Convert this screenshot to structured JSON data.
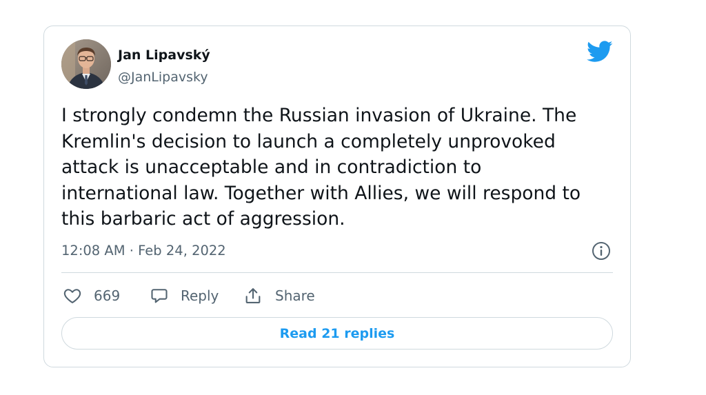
{
  "author": {
    "name": "Jan Lipavský",
    "handle": "@JanLipavsky"
  },
  "brand_icon": "twitter-bird-icon",
  "tweet": {
    "lines": [
      "I strongly condemn the Russian invasion of Ukraine. The",
      "Kremlin's decision to launch a completely unprovoked",
      "attack is unacceptable and in contradiction to",
      "international law. Together with Allies, we will respond to",
      "this barbaric act of aggression."
    ],
    "timestamp": "12:08 AM · Feb 24, 2022"
  },
  "actions": {
    "like_count": "669",
    "reply_label": "Reply",
    "share_label": "Share"
  },
  "read_replies_label": "Read 21 replies",
  "colors": {
    "accent": "#1d9bf0",
    "text": "#0f1419",
    "muted": "#536471",
    "border": "#cfd9de"
  }
}
